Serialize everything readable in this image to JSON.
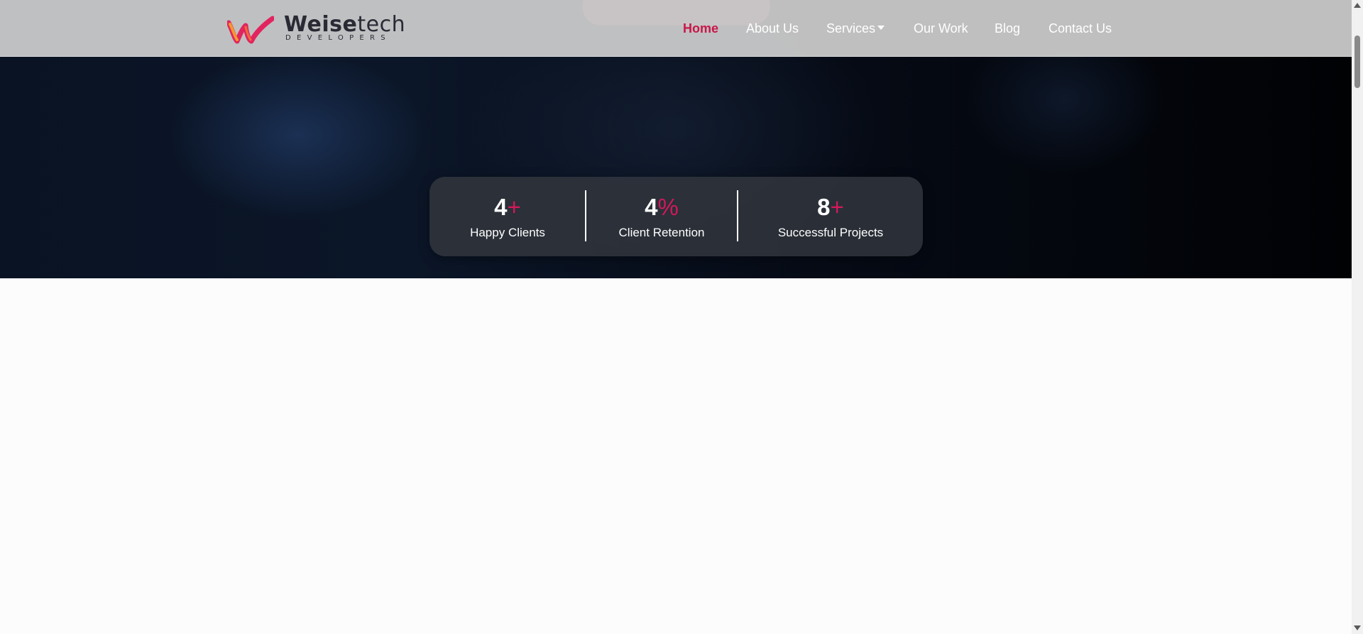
{
  "brand": {
    "name_bold": "Weise",
    "name_regular": "tech",
    "tagline": "DEVELOPERS"
  },
  "nav": {
    "items": [
      {
        "label": "Home",
        "active": true
      },
      {
        "label": "About Us",
        "active": false
      },
      {
        "label": "Services",
        "active": false,
        "dropdown": true
      },
      {
        "label": "Our Work",
        "active": false
      },
      {
        "label": "Blog",
        "active": false
      },
      {
        "label": "Contact Us",
        "active": false
      }
    ]
  },
  "stats": [
    {
      "value": "4",
      "suffix": "+",
      "label": "Happy Clients"
    },
    {
      "value": "4",
      "suffix": "%",
      "label": "Client Retention"
    },
    {
      "value": "8",
      "suffix": "+",
      "label": "Successful Projects"
    }
  ],
  "colors": {
    "accent": "#c8174a",
    "header_bg": "#cecece",
    "page_bg": "#fcfcfd"
  },
  "icons": {
    "logo": "weisetech-logo-mark",
    "dropdown": "caret-down-icon"
  }
}
